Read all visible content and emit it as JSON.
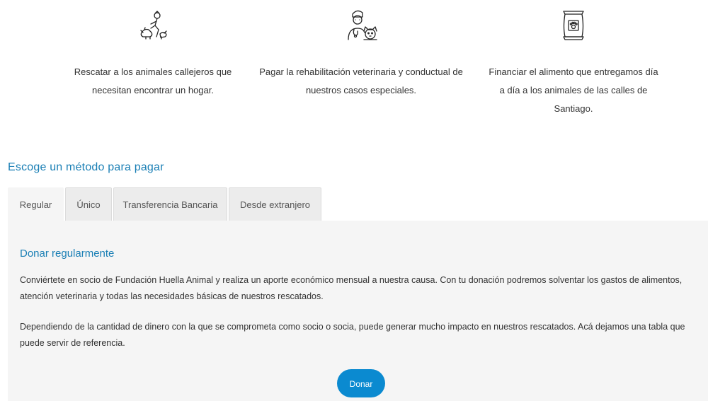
{
  "features": [
    {
      "icon": "rescuer-with-animals-icon",
      "text": "Rescatar a los animales callejeros que necesitan encontrar un hogar."
    },
    {
      "icon": "veterinarian-with-dog-icon",
      "text": "Pagar la rehabilitación veterinaria y conductual de nuestros casos especiales."
    },
    {
      "icon": "pet-food-bag-icon",
      "text": "Financiar el alimento que entregamos día a día a los animales de las calles de Santiago."
    }
  ],
  "section": {
    "title": "Escoge un método para pagar"
  },
  "tabs": [
    {
      "label": "Regular"
    },
    {
      "label": "Único"
    },
    {
      "label": "Transferencia Bancaria"
    },
    {
      "label": "Desde extranjero"
    }
  ],
  "panel": {
    "title": "Donar regularmente",
    "paragraph1": "Conviértete en socio de Fundación Huella Animal y realiza un aporte económico mensual a nuestra causa. Con tu donación podremos solventar los gastos de alimentos, atención veterinaria y todas las necesidades básicas de nuestros rescatados.",
    "paragraph2": "Dependiendo de la cantidad de dinero con la que se comprometa como socio o socia, puede generar mucho impacto en nuestros rescatados. Acá dejamos una tabla que puede servir de referencia.",
    "button_label": "Donar"
  },
  "colors": {
    "accent": "#1a7fb5",
    "button": "#0b8ad0",
    "panel_bg": "#f5f5f5",
    "tab_bg": "#ececec"
  }
}
